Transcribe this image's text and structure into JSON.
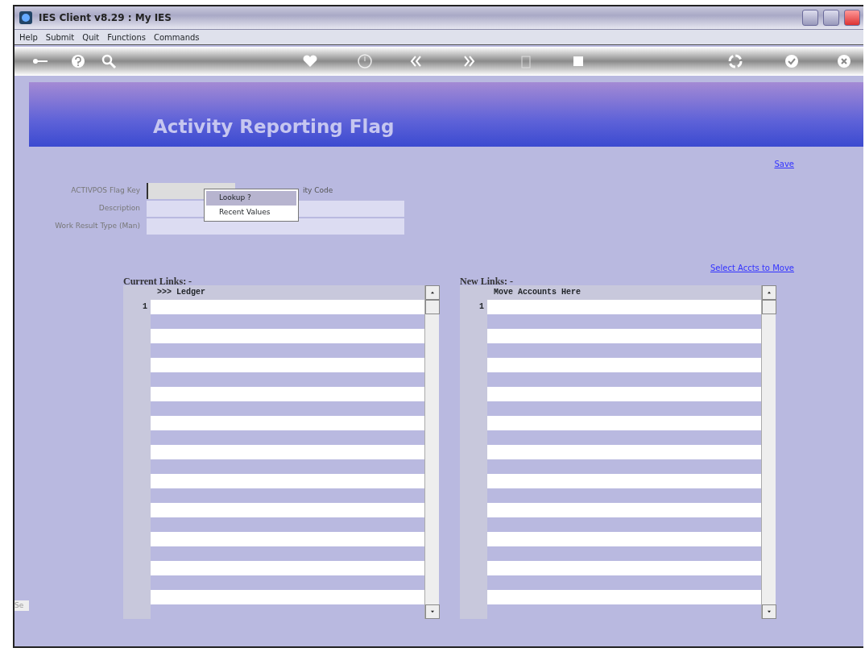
{
  "window": {
    "title": "IES Client v8.29 : My IES"
  },
  "menu": [
    "Help",
    "Submit",
    "Quit",
    "Functions",
    "Commands"
  ],
  "header": {
    "title": "Activity Reporting Flag"
  },
  "save_link": "Save",
  "form": [
    {
      "label": "ACTIVPOS Flag Key",
      "kind": "key"
    },
    {
      "label": "Description",
      "kind": "wide"
    },
    {
      "label": "Work Result Type (Man)",
      "kind": "wide"
    }
  ],
  "hidden_label": "ity Code",
  "popup": [
    {
      "label": "Lookup ?",
      "selected": true
    },
    {
      "label": "Recent Values",
      "selected": false
    }
  ],
  "select_link": "Select Accts to Move",
  "lists": [
    {
      "title": "Current Links: -",
      "header": ">>> Ledger",
      "rows": [
        {
          "number": "1"
        }
      ]
    },
    {
      "title": "New Links: -",
      "header": "Move Accounts Here",
      "rows": [
        {
          "number": "1"
        }
      ]
    }
  ],
  "side_tab": "Se"
}
